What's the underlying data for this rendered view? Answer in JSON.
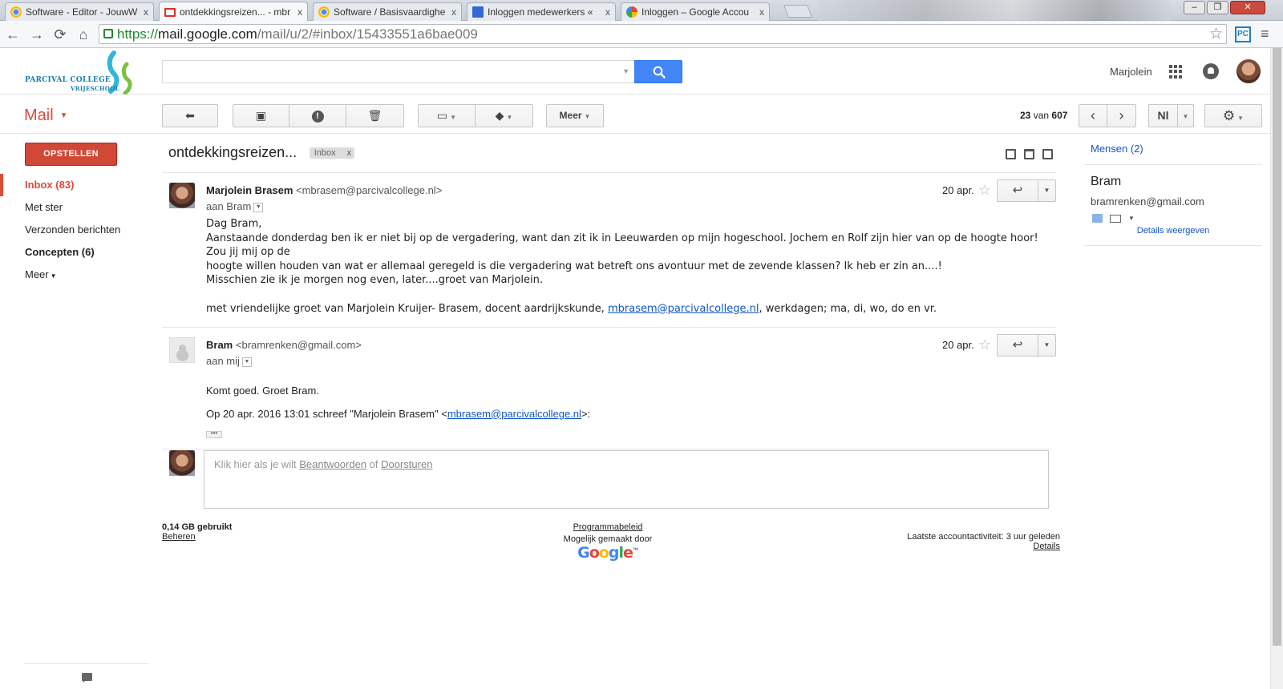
{
  "browser": {
    "tabs": [
      {
        "title": "Software - Editor - JouwW",
        "close": "x",
        "favicon_color": "#4c8bf5"
      },
      {
        "title": "ontdekkingsreizen... - mbr",
        "close": "x",
        "favicon_color": "#d93025"
      },
      {
        "title": "Software / Basisvaardighe",
        "close": "x",
        "favicon_color": "#4c8bf5"
      },
      {
        "title": "Inloggen medewerkers «",
        "close": "x",
        "favicon_color": "#3367d6"
      },
      {
        "title": "Inloggen – Google Accou",
        "close": "x",
        "favicon_color": "#4285f4"
      }
    ],
    "window_controls": {
      "minimize": "–",
      "maximize": "❐",
      "close": "✕"
    },
    "url": {
      "scheme": "https://",
      "host": "mail.google.com",
      "path": "/mail/u/2/#inbox/15433551a6bae009"
    },
    "extension_label": "PC",
    "nav_icons": {
      "back": "←",
      "forward": "→",
      "reload": "⟳",
      "home": "⌂",
      "star": "☆",
      "menu": "≡"
    }
  },
  "header": {
    "logo_line1": "PARCIVAL COLLEGE",
    "logo_line2": "VRIJESCHOOL",
    "search_placeholder": "",
    "user_name": "Marjolein"
  },
  "toolbar": {
    "mail_label": "Mail",
    "back_icon": "⬅",
    "archive_icon": "▣",
    "spam_icon": "!",
    "delete_icon": "🗑",
    "move_icon": "▭",
    "labels_icon": "◆",
    "more_label": "Meer",
    "pager_current": "23",
    "pager_sep": "van",
    "pager_total": "607",
    "prev_icon": "‹",
    "next_icon": "›",
    "lang_label": "Nl",
    "settings_icon": "⚙"
  },
  "nav": {
    "compose_label": "OPSTELLEN",
    "items": [
      {
        "label": "Inbox (83)"
      },
      {
        "label": "Met ster"
      },
      {
        "label": "Verzonden berichten"
      },
      {
        "label": "Concepten (6)"
      },
      {
        "label": "Meer"
      }
    ]
  },
  "conversation": {
    "subject": "ontdekkingsreizen...",
    "label": "Inbox",
    "label_remove": "x",
    "messages": [
      {
        "sender_name": "Marjolein Brasem",
        "sender_email": "<mbrasem@parcivalcollege.nl>",
        "to": "aan Bram",
        "date": "20 apr.",
        "body": [
          "Dag Bram,",
          "Aanstaande donderdag ben ik er niet bij op de vergadering, want dan zit ik in Leeuwarden op mijn hogeschool. Jochem en Rolf zijn hier van op de hoogte hoor! Zou jij mij op de",
          "hoogte willen houden van wat er allemaal geregeld is die vergadering wat betreft ons avontuur met de zevende klassen? Ik heb er zin an....!",
          "Misschien zie ik je morgen nog even, later....groet van Marjolein."
        ],
        "signature_pre": "met vriendelijke groet van Marjolein Kruijer- Brasem, docent aardrijkskunde, ",
        "signature_link": "mbrasem@parcivalcollege.nl",
        "signature_post": ", werkdagen; ma, di, wo, do en vr."
      },
      {
        "sender_name": "Bram",
        "sender_email": "<bramrenken@gmail.com>",
        "to": "aan mij",
        "date": "20 apr.",
        "body_line": "Komt goed.  Groet Bram.",
        "quote_pre": "Op 20 apr. 2016 13:01 schreef \"Marjolein Brasem\" <",
        "quote_link": "mbrasem@parcivalcollege.nl",
        "quote_post": ">:",
        "ellipsis": "•••"
      }
    ],
    "reply_prompt_pre": "Klik hier als je wilt ",
    "reply_link": "Beantwoorden",
    "reply_mid": " of ",
    "forward_link": "Doorsturen"
  },
  "footer": {
    "storage": "0,14 GB gebruikt",
    "manage": "Beheren",
    "policy": "Programmabeleid",
    "powered_by": "Mogelijk gemaakt door",
    "google_letters": [
      "G",
      "o",
      "o",
      "g",
      "l",
      "e"
    ],
    "google_colors": [
      "#4285f4",
      "#ea4335",
      "#fbbc05",
      "#4285f4",
      "#34a853",
      "#ea4335"
    ],
    "tm": "™",
    "last_activity": "Laatste accountactiviteit: 3 uur geleden",
    "details": "Details"
  },
  "people": {
    "title": "Mensen (2)",
    "contact_name": "Bram",
    "contact_email": "bramrenken@gmail.com",
    "details_link": "Details weergeven"
  },
  "colors": {
    "gmail_red": "#dd4b39",
    "compose_red": "#d14836",
    "search_blue": "#4285f4",
    "link_blue": "#1155cc"
  }
}
